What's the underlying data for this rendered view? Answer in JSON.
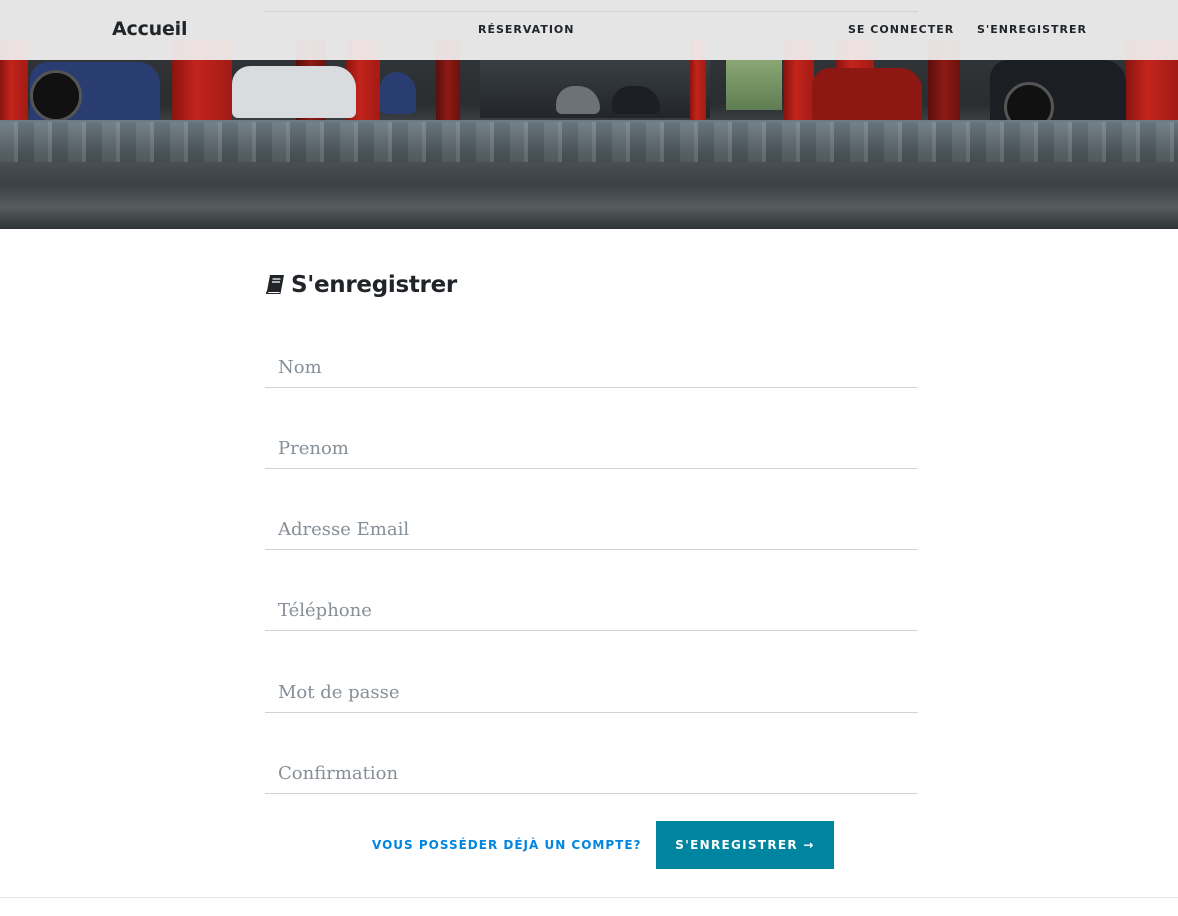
{
  "navbar": {
    "brand": "Accueil",
    "links": {
      "reservation": "RÉSERVATION",
      "login": "SE CONNECTER",
      "register": "S'ENREGISTRER"
    }
  },
  "hero": {
    "image": "parking-garage-photo"
  },
  "form": {
    "title": "S'enregistrer",
    "title_icon": "book-icon",
    "fields": {
      "nom": {
        "placeholder": "Nom",
        "value": ""
      },
      "prenom": {
        "placeholder": "Prenom",
        "value": ""
      },
      "email": {
        "placeholder": "Adresse Email",
        "value": ""
      },
      "telephone": {
        "placeholder": "Téléphone",
        "value": ""
      },
      "password": {
        "placeholder": "Mot de passe",
        "value": ""
      },
      "confirmation": {
        "placeholder": "Confirmation",
        "value": ""
      }
    },
    "login_link": "VOUS POSSÉDER DÉJÀ UN COMPTE?",
    "submit_label": "S'ENREGISTRER →"
  },
  "colors": {
    "accent": "#0085a1",
    "link": "#0085e0",
    "pillar_red": "#c3241c"
  }
}
